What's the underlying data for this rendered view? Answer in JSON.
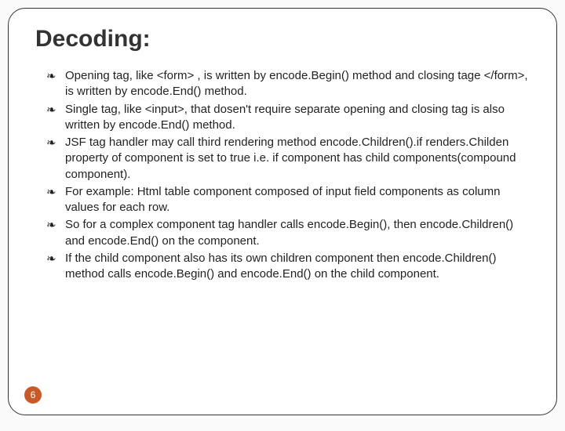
{
  "title": "Decoding:",
  "bullets": [
    "Opening tag, like <form> , is written by encode.Begin() method and closing tage </form>,  is written by encode.End() method.",
    "Single tag, like <input>, that dosen't require separate opening and closing tag is also written by encode.End() method.",
    "JSF tag handler  may call third rendering method encode.Children().if renders.Childen property of component is set to true i.e. if component has  child components(compound component).",
    "For example: Html table component composed of input field components as column values for each row.",
    "So for a complex component tag handler calls encode.Begin(), then encode.Children() and encode.End() on the component.",
    "If the child component also has its own children component then encode.Children() method calls encode.Begin() and encode.End() on the child component."
  ],
  "bullet_marker": "༄",
  "page_number": "6"
}
